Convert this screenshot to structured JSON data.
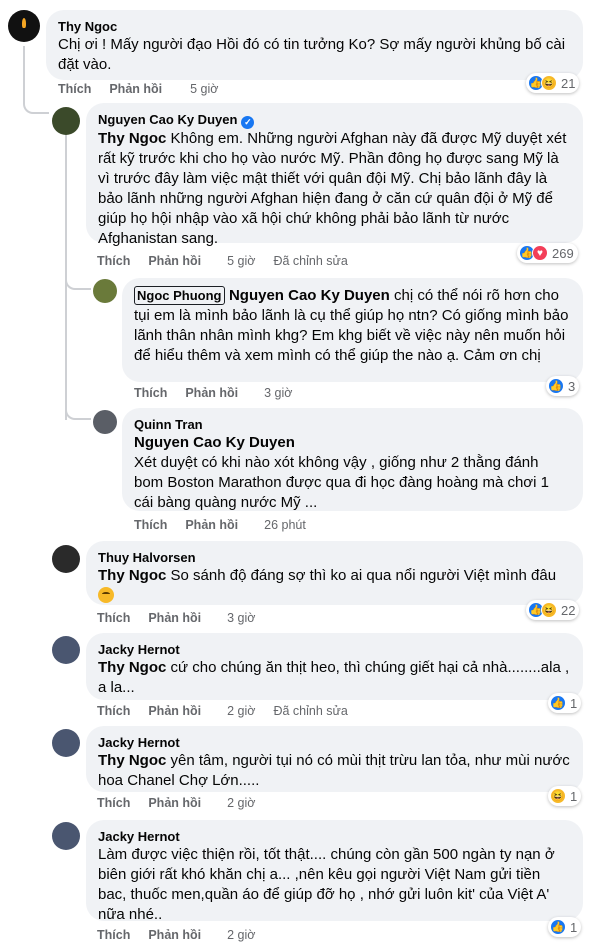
{
  "labels": {
    "like": "Thích",
    "reply": "Phản hồi",
    "edited": "Đã chỉnh sửa"
  },
  "comments": [
    {
      "name": "Thy Ngoc",
      "text": "Chị ơi ! Mấy người đạo Hồi đó có tin tưởng Ko? Sợ mấy người khủng bố cài đặt vào.",
      "time": "5 giờ",
      "reaction_count": "21",
      "reactions": [
        "like",
        "haha"
      ],
      "avatar_color": "#111111"
    },
    {
      "name": "Nguyen Cao Ky Duyen",
      "verified": true,
      "mention": "Thy Ngoc",
      "text": "Không em. Những người Afghan này đã được Mỹ duyệt xét rất kỹ trước khi cho họ vào nước Mỹ. Phần đông họ được sang Mỹ là vì trước đây làm việc mật thiết với quân đội Mỹ. Chị bảo lãnh đây là bảo lãnh những người Afghan hiện đang ở căn cứ quân đội ở Mỹ để giúp họ hội nhập vào xã hội chứ không phải bảo lãnh từ nước Afghanistan sang.",
      "time": "5 giờ",
      "edited": true,
      "reaction_count": "269",
      "reactions": [
        "like",
        "love"
      ],
      "avatar_color": "#3b4a2a"
    },
    {
      "name": "Ngoc Phuong",
      "mention": "Nguyen Cao Ky Duyen",
      "text": "chị có thể nói rõ hơn cho tụi em là mình bảo lãnh là cụ thể giúp họ ntn? Có giống mình bảo lãnh thân nhân mình khg? Em khg biết về việc này nên muốn hỏi để hiểu thêm và xem mình có thể giúp the nào ạ. Cảm ơn chị",
      "time": "3 giờ",
      "reaction_count": "3",
      "reactions": [
        "like"
      ],
      "avatar_color": "#6a7a3a"
    },
    {
      "name": "Quinn Tran",
      "mention": "Nguyen Cao Ky Duyen",
      "text": "Xét duyệt có khi nào xót không vậy , giống như 2 thằng đánh bom Boston Marathon được qua đi học đàng hoàng mà chơi 1 cái bàng quàng nước Mỹ ...",
      "time": "26 phút",
      "avatar_color": "#5a5e66"
    },
    {
      "name": "Thuy Halvorsen",
      "mention": "Thy Ngoc",
      "text": "So sánh độ đáng sợ thì ko ai qua nổi người Việt mình đâu",
      "time": "3 giờ",
      "reaction_count": "22",
      "reactions": [
        "like",
        "haha"
      ],
      "avatar_color": "#2a2a2a"
    },
    {
      "name": "Jacky Hernot",
      "mention": "Thy Ngoc",
      "text": "cứ cho chúng ăn thịt heo, thì chúng giết hại cả nhà........ala , a la...",
      "time": "2 giờ",
      "edited": true,
      "reaction_count": "1",
      "reactions": [
        "like"
      ],
      "avatar_color": "#4a5670"
    },
    {
      "name": "Jacky Hernot",
      "mention": "Thy Ngoc",
      "text": "yên tâm, người tụi nó có mùi thịt trừu lan tỏa, như mùi nước hoa Chanel Chợ Lớn.....",
      "time": "2 giờ",
      "reaction_count": "1",
      "reactions": [
        "haha"
      ],
      "avatar_color": "#4a5670"
    },
    {
      "name": "Jacky Hernot",
      "text": "Làm được việc thiện rồi, tốt thật.... chúng còn gần 500 ngàn ty nạn ở biên giới rất khó khăn chị a... ,nên kêu gọi người Việt Nam gửi tiền bac, thuốc men,quần áo để giúp đỡ họ , nhớ gửi luôn kit' của Việt A' nữa nhé..",
      "time": "2 giờ",
      "reaction_count": "1",
      "reactions": [
        "like"
      ],
      "avatar_color": "#4a5670"
    }
  ]
}
